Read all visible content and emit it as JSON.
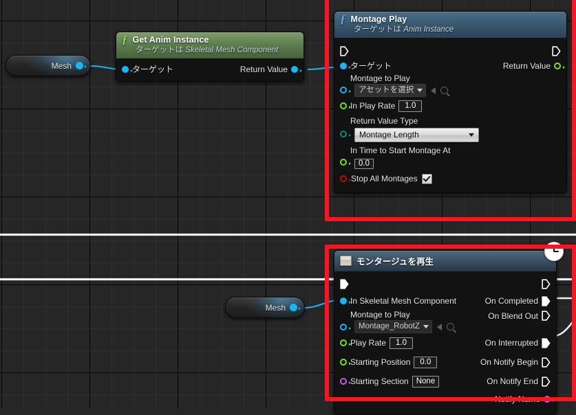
{
  "app": {
    "context": "Unreal Engine Blueprint graph comparison",
    "background_color": "#262626",
    "annotation_color": "#fe1420"
  },
  "nodes": {
    "mesh_top": {
      "label": "Mesh",
      "pin_name": "mesh-output-pin",
      "pin_color": "#16b7f5"
    },
    "get_anim_instance": {
      "title": "Get Anim Instance",
      "subtitle_prefix": "ターゲットは ",
      "subtitle_class": "Skeletal Mesh Component",
      "icon": "function-f-icon",
      "inputs": [
        {
          "label": "ターゲット",
          "type": "object",
          "color": "#16b7f5"
        }
      ],
      "outputs": [
        {
          "label": "Return Value",
          "type": "object",
          "color": "#16b7f5"
        }
      ]
    },
    "montage_play": {
      "title": "Montage Play",
      "subtitle_prefix": "ターゲットは ",
      "subtitle_class": "Anim Instance",
      "icon": "function-f-icon",
      "exec_in": "exec-in-pin",
      "exec_out": "exec-out-pin",
      "inputs": [
        {
          "label": "ターゲット",
          "type": "object",
          "color": "#16b7f5"
        },
        {
          "label": "Montage to Play",
          "type": "object",
          "color": "#16b7f5",
          "widget": "asset-picker",
          "value": "アセットを選択"
        },
        {
          "label": "In Play Rate",
          "type": "float",
          "color": "#6ee52a",
          "widget": "number",
          "value": "1.0"
        },
        {
          "label": "Return Value Type",
          "type": "enum",
          "color": "#0f8a7a",
          "widget": "combo",
          "value": "Montage Length"
        },
        {
          "label": "In Time to Start Montage At",
          "type": "float",
          "color": "#6ee52a",
          "widget": "number",
          "value": "0.0"
        },
        {
          "label": "Stop All Montages",
          "type": "bool",
          "color": "#b80f0f",
          "widget": "checkbox",
          "value": "checked"
        }
      ],
      "outputs": [
        {
          "label": "Return Value",
          "type": "float",
          "color": "#6ee52a"
        }
      ]
    },
    "mesh_bottom": {
      "label": "Mesh",
      "pin_name": "mesh-output-pin",
      "pin_color": "#16b7f5"
    },
    "play_montage": {
      "title": "モンタージュを再生",
      "icon": "montage-asset-icon",
      "badge": "clock-icon",
      "exec_in": "exec-in-pin",
      "exec_out": "exec-out-pin",
      "inputs": [
        {
          "label": "In Skeletal Mesh Component",
          "type": "object",
          "color": "#16b7f5"
        },
        {
          "label": "Montage to Play",
          "type": "object",
          "color": "#16b7f5",
          "widget": "asset-picker",
          "value": "Montage_RobotZ"
        },
        {
          "label": "Play Rate",
          "type": "float",
          "color": "#6ee52a",
          "widget": "number",
          "value": "1.0"
        },
        {
          "label": "Starting Position",
          "type": "float",
          "color": "#6ee52a",
          "widget": "number",
          "value": "0.0"
        },
        {
          "label": "Starting Section",
          "type": "name",
          "color": "#c65ae0",
          "widget": "number",
          "value": "None"
        }
      ],
      "outputs": [
        {
          "label": "On Completed",
          "type": "exec"
        },
        {
          "label": "On Blend Out",
          "type": "exec"
        },
        {
          "label": "On Interrupted",
          "type": "exec"
        },
        {
          "label": "On Notify Begin",
          "type": "exec"
        },
        {
          "label": "On Notify End",
          "type": "exec"
        },
        {
          "label": "Notify Name",
          "type": "name",
          "color": "#c65ae0"
        }
      ]
    }
  }
}
